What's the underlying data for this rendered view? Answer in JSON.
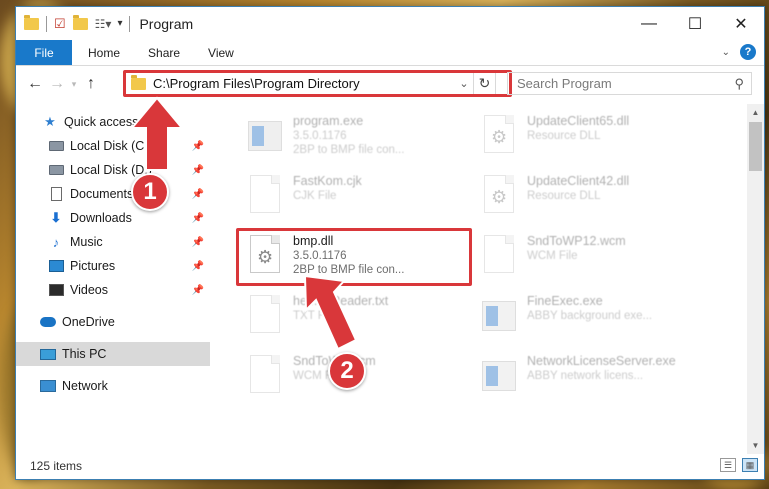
{
  "window": {
    "title": "Program",
    "controls": {
      "minimize": "—",
      "maximize": "☐",
      "close": "✕"
    }
  },
  "ribbon": {
    "tabs": [
      "File",
      "Home",
      "Share",
      "View"
    ]
  },
  "address_bar": {
    "path": "C:\\Program Files\\Program Directory"
  },
  "search": {
    "placeholder": "Search Program"
  },
  "nav_pane": {
    "items": [
      {
        "label": "Quick access",
        "icon": "star-icon",
        "pinned": false
      },
      {
        "label": "Local Disk (C:)",
        "icon": "drive-icon",
        "pinned": true
      },
      {
        "label": "Local Disk (D:)",
        "icon": "drive-icon",
        "pinned": true
      },
      {
        "label": "Documents",
        "icon": "documents-icon",
        "pinned": true
      },
      {
        "label": "Downloads",
        "icon": "downloads-icon",
        "pinned": true
      },
      {
        "label": "Music",
        "icon": "music-icon",
        "pinned": true
      },
      {
        "label": "Pictures",
        "icon": "pictures-icon",
        "pinned": true
      },
      {
        "label": "Videos",
        "icon": "videos-icon",
        "pinned": true
      },
      {
        "label": "OneDrive",
        "icon": "onedrive-icon",
        "pinned": false
      },
      {
        "label": "This PC",
        "icon": "this-pc-icon",
        "pinned": false,
        "selected": true
      },
      {
        "label": "Network",
        "icon": "network-icon",
        "pinned": false
      }
    ]
  },
  "files": [
    {
      "name": "program.exe",
      "line2": "3.5.0.1176",
      "line3": "2BP to BMP file con...",
      "icon": "exe-icon",
      "faded": true
    },
    {
      "name": "UpdateClient65.dll",
      "line2": "Resource DLL",
      "line3": "",
      "icon": "dll-icon",
      "faded": true
    },
    {
      "name": "FastKom.cjk",
      "line2": "CJK File",
      "line3": "",
      "icon": "file-icon",
      "faded": true
    },
    {
      "name": "UpdateClient42.dll",
      "line2": "Resource DLL",
      "line3": "",
      "icon": "dll-icon",
      "faded": true
    },
    {
      "name": "bmp.dll",
      "line2": "3.5.0.1176",
      "line3": "2BP to BMP file con...",
      "icon": "dll-gear-icon",
      "faded": false
    },
    {
      "name": "SndToWP12.wcm",
      "line2": "WCM File",
      "line3": "",
      "icon": "file-icon",
      "faded": true
    },
    {
      "name": "he...neReader.txt",
      "line2": "TXT File",
      "line3": "",
      "icon": "file-icon",
      "faded": true
    },
    {
      "name": "FineExec.exe",
      "line2": "ABBY background exe...",
      "line3": "",
      "icon": "exe-icon",
      "faded": true
    },
    {
      "name": "SndToW...wcm",
      "line2": "WCM File",
      "line3": "",
      "icon": "file-icon",
      "faded": true
    },
    {
      "name": "NetworkLicenseServer.exe",
      "line2": "ABBY network licens...",
      "line3": "",
      "icon": "exe-icon",
      "faded": true
    }
  ],
  "status": {
    "item_count": "125 items"
  },
  "annotations": {
    "step1": "1",
    "step2": "2",
    "color": "#d9373a"
  }
}
